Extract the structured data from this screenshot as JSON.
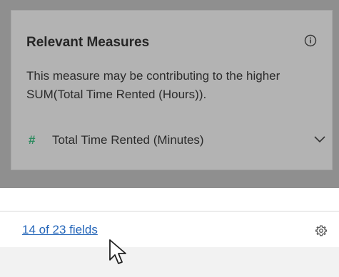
{
  "panel": {
    "title": "Relevant Measures",
    "description": "This measure may be contributing to the higher SUM(Total Time Rented (Hours)).",
    "measure": {
      "type_icon": "#",
      "label": "Total Time Rented (Minutes)"
    }
  },
  "footer": {
    "fields_link": "14 of 23 fields"
  },
  "colors": {
    "overlay": "#8f8f8f",
    "card": "#b3b3b3",
    "link": "#2566b9",
    "measure_icon": "#2a8a5d"
  },
  "icons": {
    "info": "info-icon",
    "expand": "chevron-down-icon",
    "settings": "gear-icon",
    "pointer": "mouse-pointer-icon"
  }
}
